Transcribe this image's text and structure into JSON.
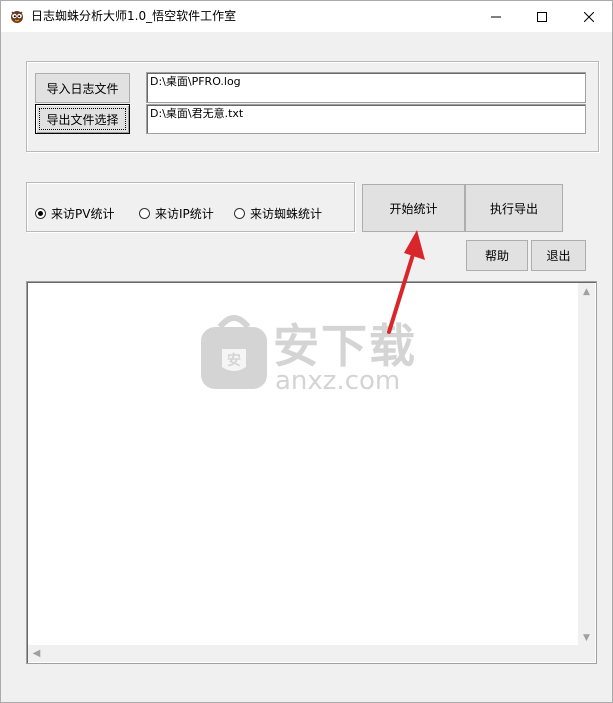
{
  "window": {
    "title": "日志蜘蛛分析大师1.0_悟空软件工作室",
    "controls": {
      "minimize_icon": "minimize-icon",
      "maximize_icon": "maximize-icon",
      "close_icon": "close-icon"
    }
  },
  "file_section": {
    "import_label": "导入日志文件",
    "export_select_label": "导出文件选择",
    "log_path": "D:\\桌面\\PFRO.log",
    "output_path": "D:\\桌面\\君无意.txt"
  },
  "stats_options": {
    "selected": "来访PV统计",
    "options": [
      "来访PV统计",
      "来访IP统计",
      "来访蜘蛛统计"
    ]
  },
  "actions": {
    "start_label": "开始统计",
    "export_label": "执行导出",
    "help_label": "帮助",
    "exit_label": "退出"
  },
  "watermark": {
    "brand_cn": "安下载",
    "brand_url": "anxz.com"
  },
  "colors": {
    "window_bg": "#f0f0f0",
    "titlebar_bg": "#ffffff",
    "button_bg": "#e1e1e1",
    "annotation_arrow": "#d9262a",
    "watermark": "#d4d4d4"
  }
}
